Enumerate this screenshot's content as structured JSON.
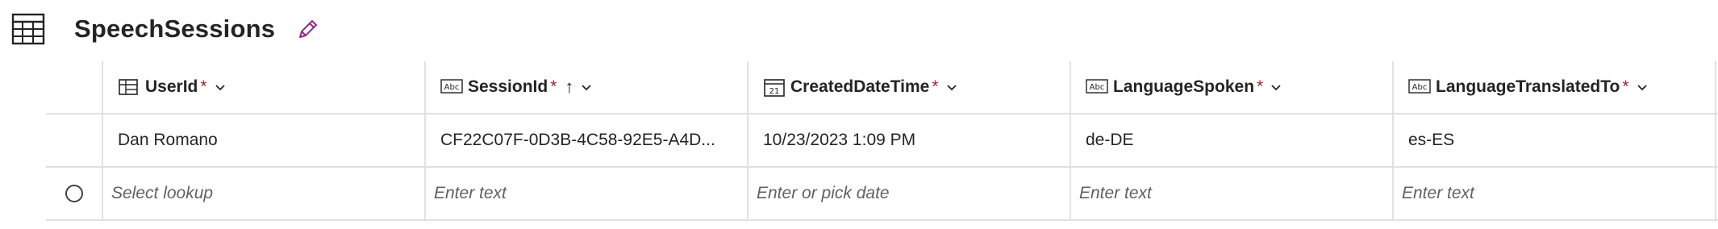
{
  "header": {
    "title": "SpeechSessions",
    "table_icon": "table-grid-icon",
    "edit_icon": "pencil-edit-icon",
    "accent_color": "#8a2d8f"
  },
  "columns": [
    {
      "name": "UserId",
      "icon": "lookup-icon",
      "required": "*",
      "sorted": ""
    },
    {
      "name": "SessionId",
      "icon": "text-abc-icon",
      "required": "*",
      "sorted": "↑"
    },
    {
      "name": "CreatedDateTime",
      "icon": "calendar-icon",
      "required": "*",
      "sorted": ""
    },
    {
      "name": "LanguageSpoken",
      "icon": "text-abc-icon",
      "required": "*",
      "sorted": ""
    },
    {
      "name": "LanguageTranslatedTo",
      "icon": "text-abc-icon",
      "required": "*",
      "sorted": ""
    }
  ],
  "rows": [
    {
      "UserId": "Dan Romano",
      "SessionId": "CF22C07F-0D3B-4C58-92E5-A4D...",
      "CreatedDateTime": "10/23/2023 1:09 PM",
      "LanguageSpoken": "de-DE",
      "LanguageTranslatedTo": "es-ES"
    }
  ],
  "new_row": {
    "UserId": "Select lookup",
    "SessionId": "Enter text",
    "CreatedDateTime": "Enter or pick date",
    "LanguageSpoken": "Enter text",
    "LanguageTranslatedTo": "Enter text"
  },
  "colors": {
    "required": "#a4262c",
    "border": "#e1e1e1",
    "placeholder": "#616161"
  }
}
